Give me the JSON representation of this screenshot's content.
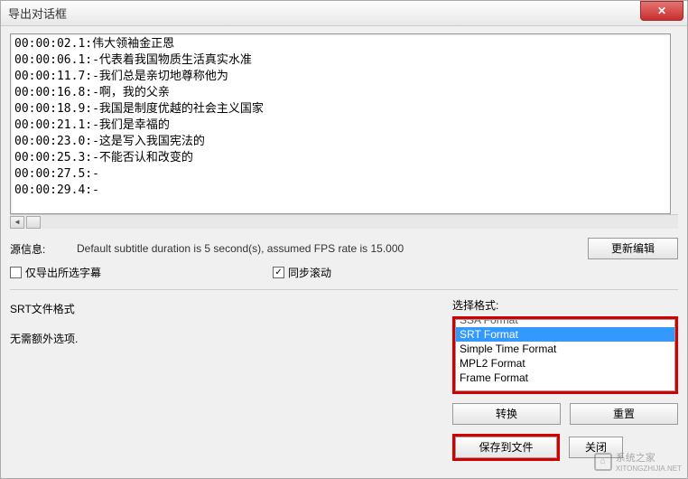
{
  "window": {
    "title": "导出对话框"
  },
  "preview": {
    "lines": [
      "00:00:02.1:伟大领袖金正恩",
      "00:00:06.1:-代表着我国物质生活真实水准",
      "00:00:11.7:-我们总是亲切地尊称他为",
      "00:00:16.8:-啊，我的父亲",
      "00:00:18.9:-我国是制度优越的社会主义国家",
      "00:00:21.1:-我们是幸福的",
      "00:00:23.0:-这是写入我国宪法的",
      "00:00:25.3:-不能否认和改变的",
      "00:00:27.5:-",
      "00:00:29.4:-"
    ]
  },
  "source": {
    "label": "源信息:",
    "text": "Default subtitle duration is 5 second(s), assumed FPS rate is 15.000",
    "update_btn": "更新编辑"
  },
  "options": {
    "export_selected_only": "仅导出所选字幕",
    "sync_scroll": "同步滚动"
  },
  "format": {
    "srt_label": "SRT文件格式",
    "no_extra": "无需额外选项.",
    "select_label": "选择格式:",
    "items": [
      "SSA Format",
      "SRT Format",
      "Simple Time Format",
      "MPL2 Format",
      "Frame Format"
    ],
    "selected_index": 1
  },
  "buttons": {
    "convert": "转换",
    "reset": "重置",
    "save": "保存到文件",
    "close": "关闭"
  },
  "watermark": {
    "text1": "系统之家",
    "text2": "XITONGZHIJIA.NET"
  }
}
